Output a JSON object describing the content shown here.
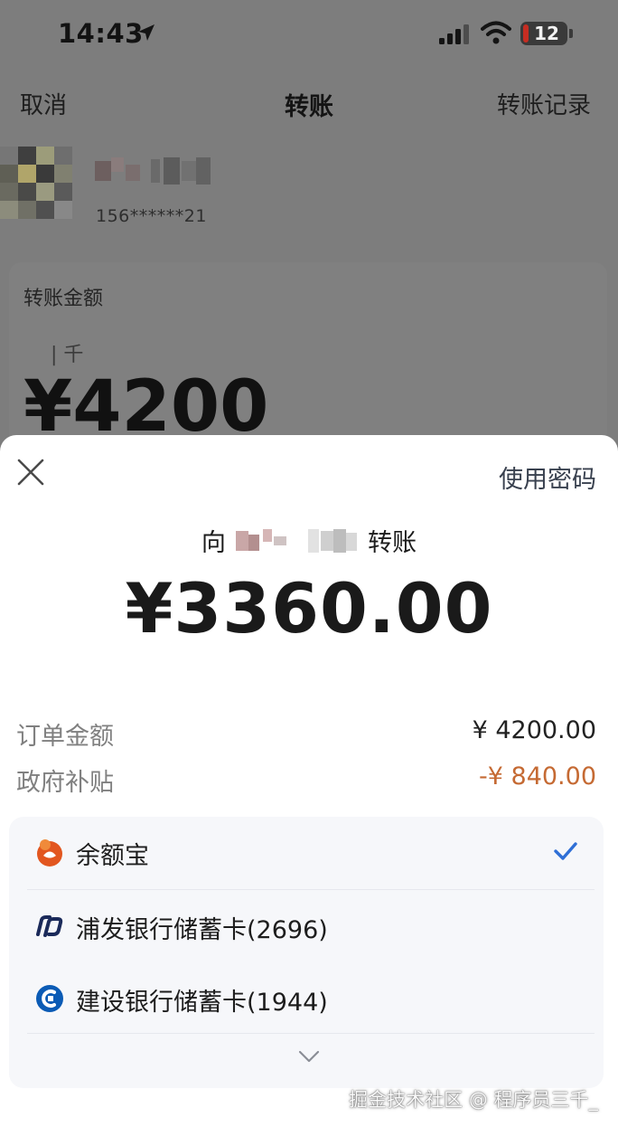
{
  "status_bar": {
    "time": "14:43",
    "battery": "12",
    "icons": [
      "location-arrow-icon",
      "signal-icon",
      "wifi-icon",
      "battery-icon"
    ]
  },
  "nav": {
    "cancel": "取消",
    "title": "转账",
    "records": "转账记录"
  },
  "recipient": {
    "phone": "156******21"
  },
  "amount_card": {
    "label": "转账金额",
    "unit_hint": "| 千",
    "value": "¥4200"
  },
  "payment_sheet": {
    "use_password": "使用密码",
    "payee_prefix": "向",
    "payee_suffix": "转账",
    "amount": "¥3360.00",
    "rows": [
      {
        "label": "订单金额",
        "value": "¥ 4200.00"
      },
      {
        "label": "政府补贴",
        "value": "-¥ 840.00"
      }
    ],
    "methods": [
      {
        "label": "余额宝",
        "icon": "yuebao-icon",
        "selected": true
      },
      {
        "label": "浦发银行储蓄卡(2696)",
        "icon": "spdb-bank-icon",
        "selected": false
      },
      {
        "label": "建设银行储蓄卡(1944)",
        "icon": "ccb-bank-icon",
        "selected": false
      }
    ],
    "colors": {
      "accent": "#2f6fd6",
      "discount": "#c56a33"
    }
  },
  "watermark": "掘金技术社区 @ 程序员三千_"
}
